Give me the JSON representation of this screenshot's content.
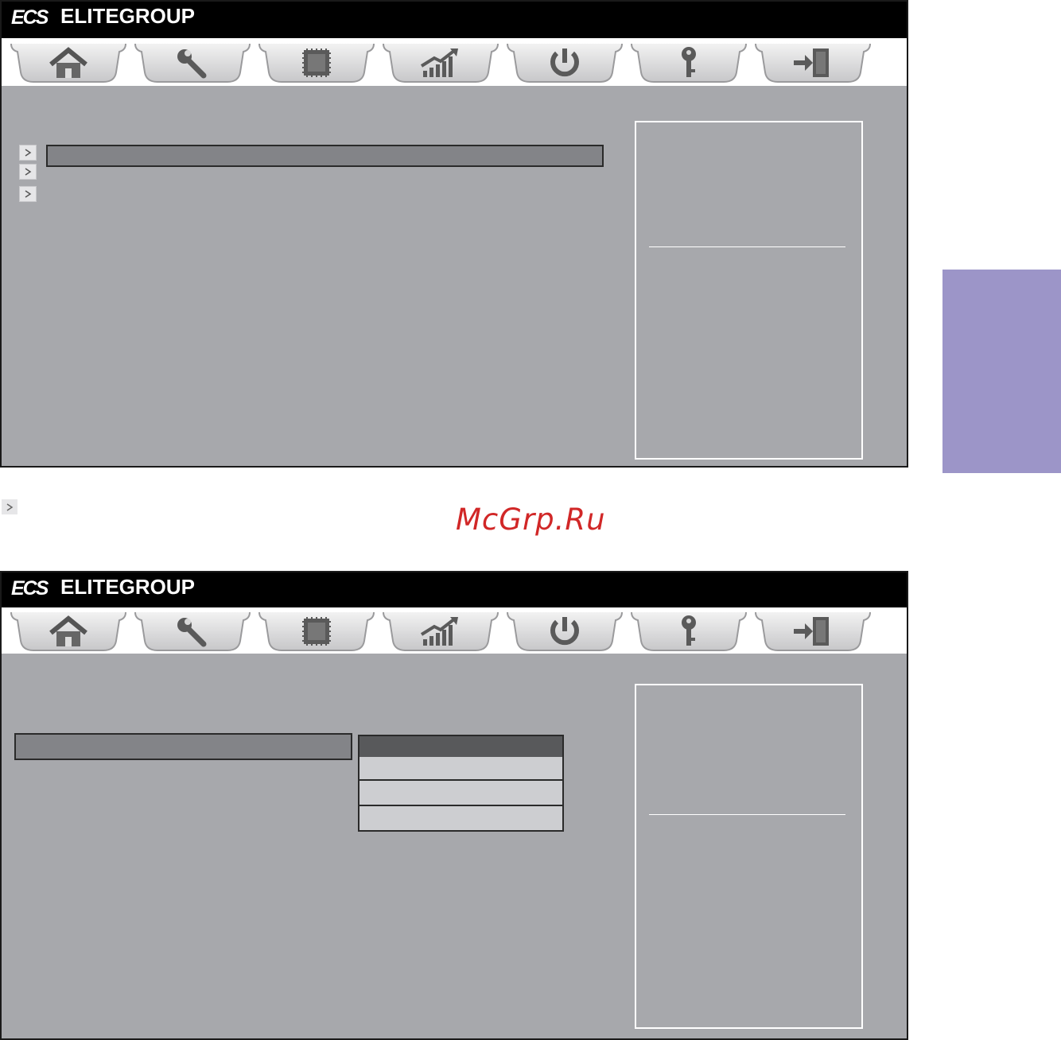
{
  "brand": {
    "mark": "ECS",
    "name": "ELITEGROUP"
  },
  "tabs": [
    {
      "icon": "home-icon"
    },
    {
      "icon": "wrench-icon"
    },
    {
      "icon": "chip-icon"
    },
    {
      "icon": "chart-icon"
    },
    {
      "icon": "power-icon"
    },
    {
      "icon": "key-icon"
    },
    {
      "icon": "exit-icon"
    }
  ],
  "watermark": "McGrp.Ru",
  "colors": {
    "panel_bg": "#a7a8ac",
    "selected_row": "#838488",
    "side_tab": "#9c95c8",
    "watermark": "#d12727"
  }
}
